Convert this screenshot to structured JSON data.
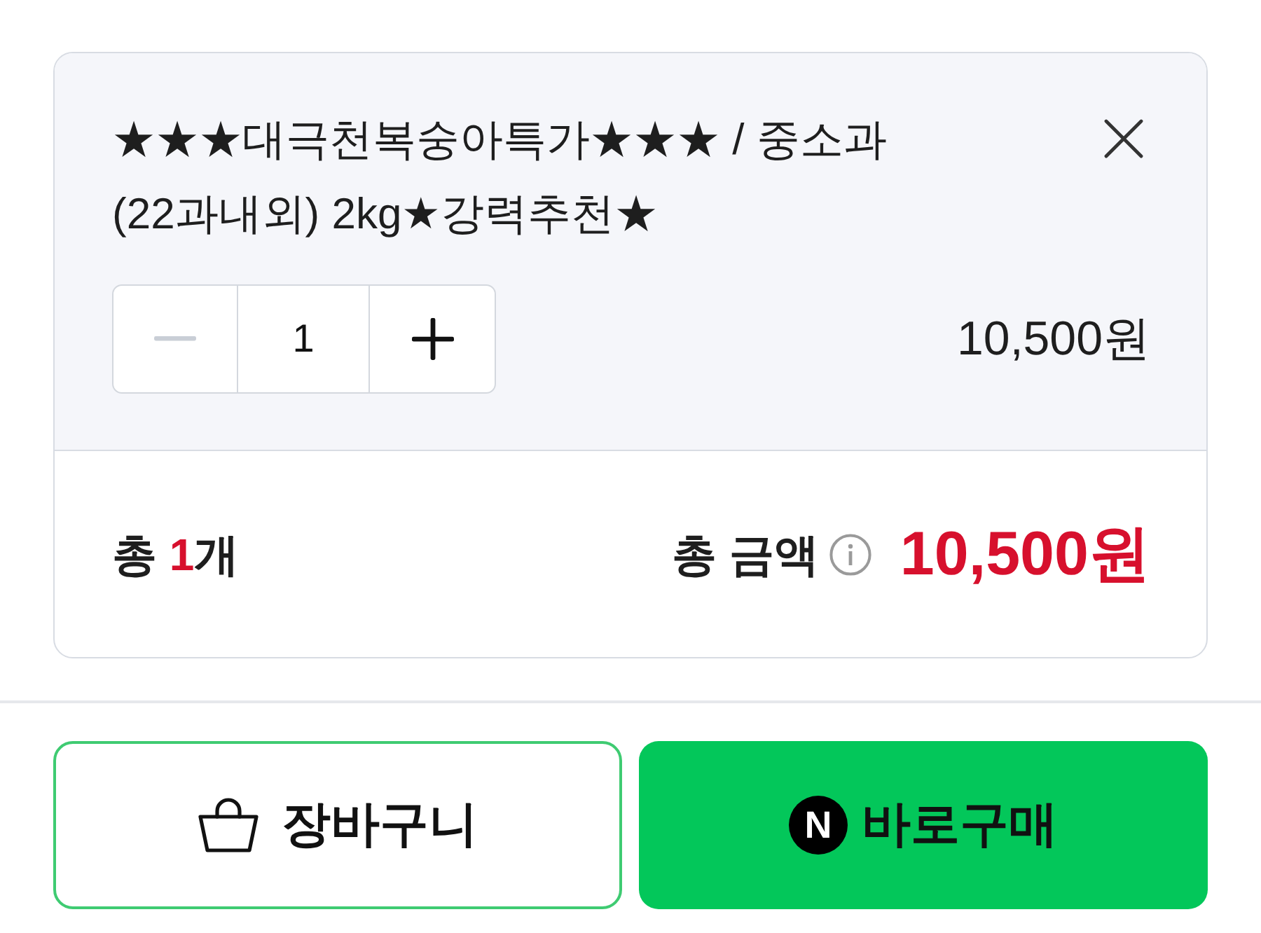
{
  "item": {
    "title": "★★★대극천복숭아특가★★★ / 중소과 (22과내외) 2kg★강력추천★",
    "stepper": {
      "decrease": {
        "disabled": true
      },
      "value": "1",
      "increase": {
        "disabled": false
      }
    },
    "price": "10,500원"
  },
  "summary": {
    "count": {
      "prefix": "총",
      "value": "1",
      "suffix": "개"
    },
    "total_label": "총 금액",
    "total": "10,500원"
  },
  "buttons": [
    {
      "kind": "cart",
      "label": "장바구니"
    },
    {
      "kind": "buy",
      "label": "바로구매",
      "logo_letter": "N"
    }
  ]
}
